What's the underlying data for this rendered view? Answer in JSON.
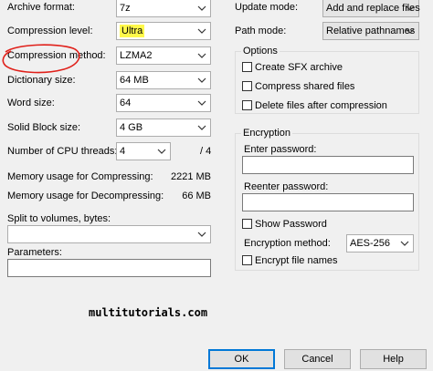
{
  "left": {
    "archive_format": {
      "label": "Archive format:",
      "value": "7z"
    },
    "compression_level": {
      "label": "Compression level:",
      "value": "Ultra"
    },
    "compression_method": {
      "label": "Compression method:",
      "value": "LZMA2"
    },
    "dictionary_size": {
      "label": "Dictionary size:",
      "value": "64 MB"
    },
    "word_size": {
      "label": "Word size:",
      "value": "64"
    },
    "solid_block_size": {
      "label": "Solid Block size:",
      "value": "4 GB"
    },
    "cpu_threads": {
      "label": "Number of CPU threads:",
      "value": "4",
      "total": "/ 4"
    },
    "mem_compress": {
      "label": "Memory usage for Compressing:",
      "value": "2221 MB"
    },
    "mem_decompress": {
      "label": "Memory usage for Decompressing:",
      "value": "66 MB"
    },
    "split": {
      "label": "Split to volumes, bytes:",
      "value": ""
    },
    "parameters": {
      "label": "Parameters:",
      "value": ""
    }
  },
  "right": {
    "update_mode": {
      "label": "Update mode:",
      "value": "Add and replace files"
    },
    "path_mode": {
      "label": "Path mode:",
      "value": "Relative pathnames"
    },
    "options": {
      "title": "Options",
      "items": [
        "Create SFX archive",
        "Compress shared files",
        "Delete files after compression"
      ]
    },
    "encryption": {
      "title": "Encryption",
      "enter_password_label": "Enter password:",
      "reenter_password_label": "Reenter password:",
      "show_password_label": "Show Password",
      "method_label": "Encryption method:",
      "method_value": "AES-256",
      "encrypt_names_label": "Encrypt file names"
    }
  },
  "watermark": "multitutorials.com",
  "buttons": {
    "ok": "OK",
    "cancel": "Cancel",
    "help": "Help"
  },
  "colors": {
    "highlight": "#fff84a",
    "annotation_circle": "#e0201a",
    "default_button_border": "#0078d7"
  },
  "icons": {
    "dropdown": "chevron-down-icon"
  }
}
